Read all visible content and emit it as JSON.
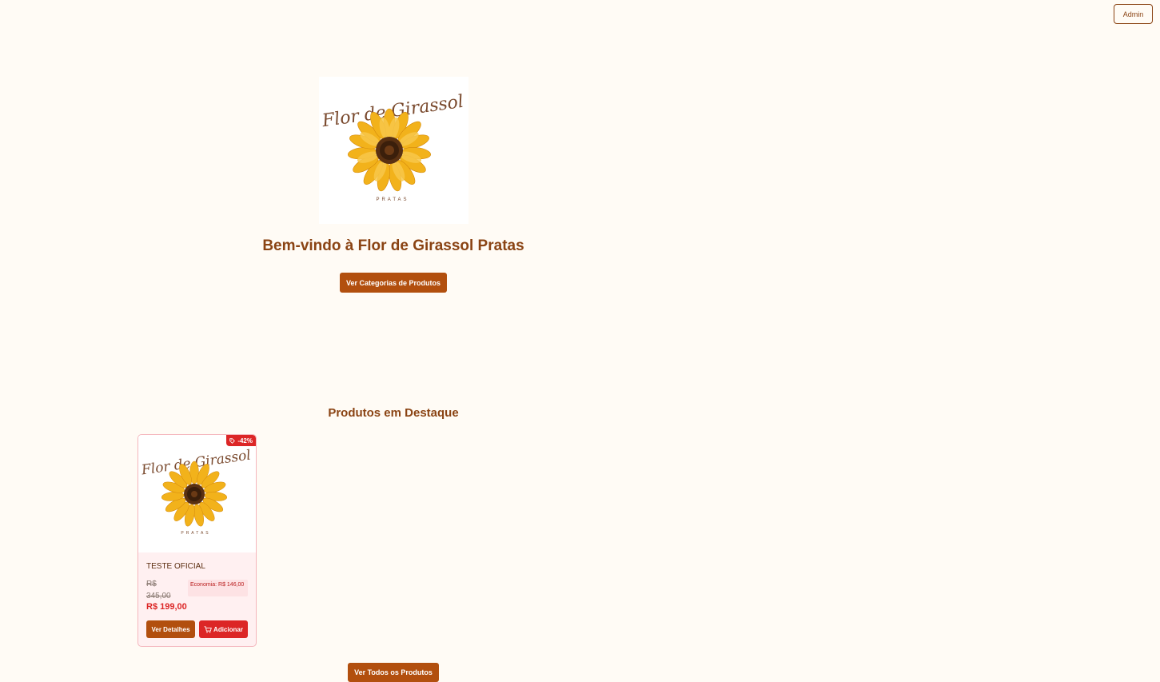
{
  "header": {
    "admin_label": "Admin"
  },
  "hero": {
    "logo": {
      "script_text": "Flor de Girassol",
      "subtitle": "PRATAS"
    },
    "title": "Bem-vindo à Flor de Girassol Pratas",
    "categories_button": "Ver Categorias de Produtos"
  },
  "featured": {
    "title": "Produtos em Destaque",
    "products": [
      {
        "name": "TESTE OFICIAL",
        "discount": "-42%",
        "old_price": "R$ 345,00",
        "saving": "Economia: R$ 146,00",
        "price": "R$ 199,00",
        "details_button": "Ver Detalhes",
        "add_button": "Adicionar"
      }
    ],
    "all_button": "Ver Todos os Produtos"
  },
  "colors": {
    "background": "#fffbf5",
    "brand_brown": "#b24f0e",
    "text_brown": "#8a4313",
    "sale_red": "#dc2626"
  }
}
